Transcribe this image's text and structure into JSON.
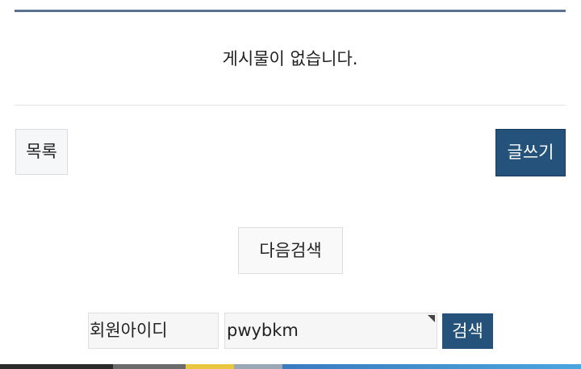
{
  "board": {
    "empty_message": "게시물이 없습니다."
  },
  "actions": {
    "list_label": "목록",
    "write_label": "글쓰기",
    "next_search_label": "다음검색"
  },
  "search": {
    "field_selected": "회원아이디",
    "query_value": "pwybkm",
    "submit_label": "검색"
  },
  "colors": {
    "accent": "#24527a",
    "top_rule": "#5a7191"
  }
}
